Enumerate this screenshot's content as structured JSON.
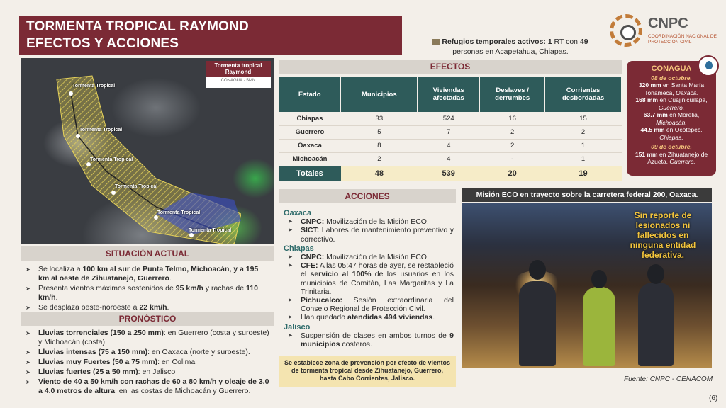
{
  "title": {
    "line1": "TORMENTA TROPICAL RAYMOND",
    "line2": "EFECTOS Y ACCIONES"
  },
  "refugios": {
    "label": "Refugios temporales activos:",
    "count": "1",
    "rt_con": "RT con",
    "people": "49",
    "location": "personas en Acapetahua, Chiapas."
  },
  "logo": {
    "name": "CNPC",
    "subtitle": "COORDINACIÓN NACIONAL DE PROTECCIÓN CIVIL"
  },
  "map": {
    "badge_title": "Tormenta tropical Raymond",
    "badge_logos": "CONAGUA · SMN",
    "track_labels": [
      "Tormenta Tropical",
      "Tormenta Tropical",
      "Tormenta Tropical",
      "Tormenta Tropical",
      "Tormenta Tropical",
      "Tormenta Tropical"
    ]
  },
  "situacion": {
    "header": "SITUACIÓN ACTUAL",
    "items": [
      {
        "pre": "Se localiza a ",
        "bold": "100 km al sur de Punta Telmo, Michoacán, y a 195 km al oeste de Zihuatanejo, Guerrero",
        "post": "."
      },
      {
        "pre": "Presenta vientos máximos sostenidos de ",
        "bold": "95 km/h",
        "mid": " y rachas de ",
        "bold2": "110 km/h",
        "post": "."
      },
      {
        "pre": "Se desplaza oeste-noroeste a ",
        "bold": "22 km/h",
        "post": "."
      }
    ]
  },
  "pronostico": {
    "header": "PRONÓSTICO",
    "items": [
      {
        "bold": "Lluvias torrenciales (150 a 250 mm)",
        "text": ": en Guerrero (costa y suroeste) y Michoacán (costa)."
      },
      {
        "bold": "Lluvias intensas (75 a 150 mm)",
        "text": ": en Oaxaca (norte y suroeste)."
      },
      {
        "bold": "Lluvias muy Fuertes (50 a 75 mm)",
        "text": ": en Colima"
      },
      {
        "bold": "Lluvias fuertes (25 a 50 mm)",
        "text": ": en Jalisco"
      },
      {
        "bold": "Viento de 40 a 50 km/h con rachas de 60 a 80 km/h y oleaje de 3.0 a 4.0 metros de altura",
        "text": ": en las costas de Michoacán y Guerrero."
      }
    ]
  },
  "efectos": {
    "header": "EFECTOS",
    "columns": [
      "Estado",
      "Municipios",
      "Viviendas afectadas",
      "Deslaves / derrumbes",
      "Corrientes desbordadas"
    ],
    "rows": [
      [
        "Chiapas",
        "33",
        "524",
        "16",
        "15"
      ],
      [
        "Guerrero",
        "5",
        "7",
        "2",
        "2"
      ],
      [
        "Oaxaca",
        "8",
        "4",
        "2",
        "1"
      ],
      [
        "Michoacán",
        "2",
        "4",
        "-",
        "1"
      ]
    ],
    "totals": [
      "Totales",
      "48",
      "539",
      "20",
      "19"
    ]
  },
  "conagua": {
    "title": "CONAGUA",
    "date1": "08 de octubre.",
    "entries1": [
      {
        "bold": "320 mm",
        "text": " en Santa María Tonameca, ",
        "place": "Oaxaca."
      },
      {
        "bold": "168 mm",
        "text": " en Cuajinicuilapa, ",
        "place": "Guerrero."
      },
      {
        "bold": "63.7 mm",
        "text": " en Morelia, ",
        "place": "Michoacán."
      },
      {
        "bold": "44.5 mm",
        "text": " en Ocotepec, ",
        "place": "Chiapas."
      }
    ],
    "date2": "09 de octubre.",
    "entries2": [
      {
        "bold": "151 mm",
        "text": " en Zihuatanejo de Azueta, ",
        "place": "Guerrero."
      }
    ]
  },
  "acciones": {
    "header": "ACCIONES",
    "regions": [
      {
        "name": "Oaxaca",
        "items": [
          {
            "bold": "CNPC:",
            "text": " Movilización de la Misión ECO."
          },
          {
            "bold": "SICT:",
            "text": " Labores de mantenimiento preventivo y correctivo."
          }
        ]
      },
      {
        "name": "Chiapas",
        "items": [
          {
            "bold": "CNPC:",
            "text": " Movilización de la Misión ECO."
          },
          {
            "bold": "CFE:",
            "text": " A las 05:47 horas de ayer, se restableció el ",
            "bold2": "servicio al 100%",
            "text2": " de los usuarios en los municipios de Comitán, Las Margaritas y La Trinitaria."
          },
          {
            "bold": "Pichucalco:",
            "text": " Sesión extraordinaria del Consejo Regional de Protección Civil."
          },
          {
            "bold": "",
            "text": "Han quedado ",
            "bold2": "atendidas 494 viviendas",
            "text2": "."
          }
        ]
      },
      {
        "name": "Jalisco",
        "items": [
          {
            "bold": "",
            "text": "Suspensión de clases en ambos turnos de ",
            "bold2": "9 municipios",
            "text2": " costeros."
          }
        ]
      }
    ]
  },
  "zona": "Se establece zona de prevención por efecto de vientos de tormenta tropical desde Zihuatanejo, Guerrero, hasta Cabo Corrientes, Jalisco.",
  "eco": {
    "header": "Misión ECO en trayecto sobre la carretera federal 200, Oaxaca.",
    "note": "Sin reporte de lesionados ni fallecidos en ninguna entidad federativa."
  },
  "source": "Fuente: CNPC - CENACOM",
  "page": "(6)"
}
